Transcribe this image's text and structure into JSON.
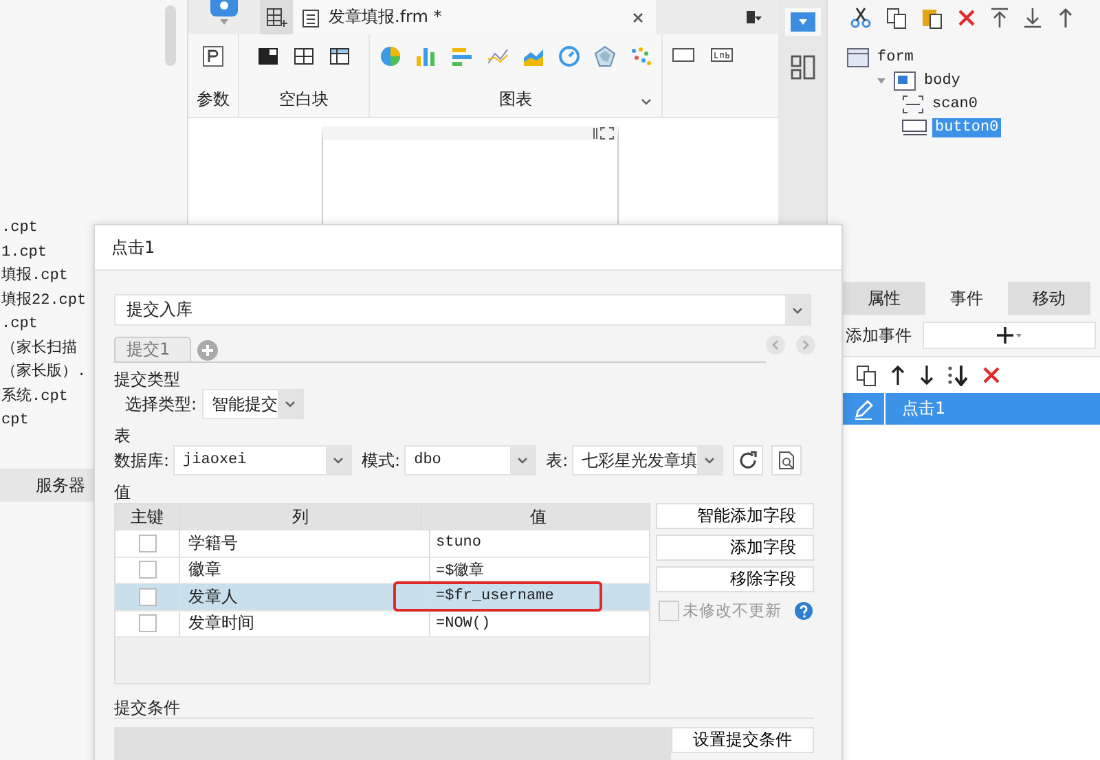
{
  "file_list": {
    "items": [
      ".cpt",
      "1.cpt",
      "填报.cpt",
      "填报22.cpt",
      ".cpt",
      "（家长扫描",
      "（家长版）.",
      "系统.cpt",
      "cpt"
    ],
    "footer": "服务器"
  },
  "editor": {
    "tab": {
      "title": "发章填报.frm *",
      "selected": true
    },
    "toolbar_groups": [
      {
        "label": "参数",
        "kind": "param"
      },
      {
        "label": "空白块",
        "kind": "blank"
      },
      {
        "label": "图表",
        "kind": "chart"
      },
      {
        "kind": "widget"
      }
    ]
  },
  "component_tree": [
    {
      "label": "form",
      "kind": "form",
      "selected": false,
      "children": [
        {
          "label": "body",
          "kind": "body",
          "selected": false,
          "expanded": true,
          "children": [
            {
              "label": "scan0",
              "kind": "scan",
              "selected": false
            },
            {
              "label": "button0",
              "kind": "button",
              "selected": true
            }
          ]
        }
      ]
    }
  ],
  "properties_panel": {
    "tabs": [
      {
        "label": "属性",
        "selected": false
      },
      {
        "label": "事件",
        "selected": true
      },
      {
        "label": "移动",
        "selected": false
      }
    ],
    "add_event_label": "添加事件",
    "events": [
      {
        "label": "点击1",
        "selected": true
      }
    ]
  },
  "dialog": {
    "title": "点击1",
    "action": "提交入库",
    "tabs": [
      {
        "label": "提交1",
        "selected": true
      }
    ],
    "submit_type_heading": "提交类型",
    "type_label": "选择类型:",
    "type_value": "智能提交",
    "table_heading": "表",
    "database_label": "数据库:",
    "database": "jiaoxei",
    "schema_label": "模式:",
    "schema": "dbo",
    "table_label": "表:",
    "table": "七彩星光发章填",
    "values_heading": "值",
    "columns": [
      "主键",
      "列",
      "值"
    ],
    "rows": [
      {
        "primary_key": false,
        "column": "学籍号",
        "value": "stuno",
        "selected": false,
        "highlighted": false
      },
      {
        "primary_key": false,
        "column": "徽章",
        "value": "=$徽章",
        "selected": false,
        "highlighted": false
      },
      {
        "primary_key": false,
        "column": "发章人",
        "value": "=$fr_username",
        "selected": true,
        "highlighted": true
      },
      {
        "primary_key": false,
        "column": "发章时间",
        "value": "=NOW()",
        "selected": false,
        "highlighted": false
      }
    ],
    "buttons": [
      "智能添加字段",
      "添加字段",
      "移除字段"
    ],
    "skip_unchanged": {
      "label": "未修改不更新",
      "checked": false,
      "disabled": true
    },
    "condition_heading": "提交条件",
    "condition_button": "设置提交条件"
  }
}
